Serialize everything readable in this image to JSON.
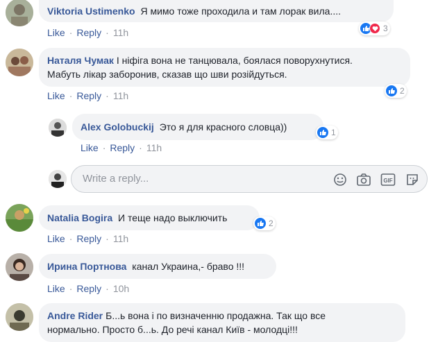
{
  "comments": [
    {
      "author": "Viktoria Ustimenko",
      "text": "Я мимо тоже проходила и там лорак вила....",
      "like": "Like",
      "reply": "Reply",
      "time": "11h",
      "reactions": "3"
    },
    {
      "author": "Наталя Чумак",
      "text": "І нiфiга вона не танцювала, боялася поворухнутися.",
      "text2": "Мабуть лiкар заборонив, сказав що шви розiйдуться.",
      "like": "Like",
      "reply": "Reply",
      "time": "11h",
      "reactions": "2"
    },
    {
      "author": "Alex Golobuckij",
      "text": "Это я для красного словца))",
      "like": "Like",
      "reply": "Reply",
      "time": "11h",
      "reactions": "1"
    },
    {
      "author": "Natalia Bogira",
      "text": "И теще надо выключить",
      "like": "Like",
      "reply": "Reply",
      "time": "11h",
      "reactions": "2"
    },
    {
      "author": "Ирина Портнова",
      "text": "канал Украина,- браво !!!",
      "like": "Like",
      "reply": "Reply",
      "time": "10h"
    },
    {
      "author": "Andre Rider",
      "text": "Б...ь вона і по визначенню продажна. Так що все",
      "text2": "нормально. Просто б...ь. До речі канал Київ - молодці!!!"
    }
  ],
  "reply_box": {
    "placeholder": "Write a reply...",
    "icons": [
      "emoji-icon",
      "camera-icon",
      "gif-icon",
      "sticker-icon"
    ],
    "gif_label": "GIF"
  },
  "colors": {
    "link": "#385898",
    "muted": "#90949c",
    "bubble": "#f2f3f5",
    "like": "#1877f2",
    "love": "#f0284a"
  }
}
